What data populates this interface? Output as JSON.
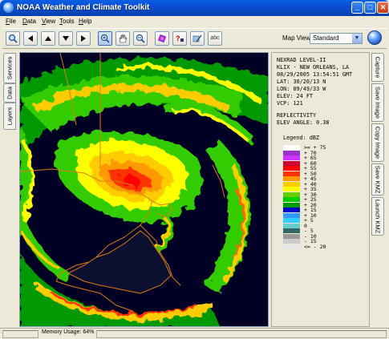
{
  "window": {
    "title": "NOAA Weather and Climate Toolkit",
    "minimize_label": "_",
    "maximize_label": "□",
    "close_label": "✕"
  },
  "menu": [
    "File",
    "Data",
    "View",
    "Tools",
    "Help"
  ],
  "toolbar": {
    "buttons": [
      "zoom-fit",
      "back",
      "up",
      "down",
      "forward",
      "zoom-in",
      "pan",
      "zoom-out",
      "palette",
      "identify",
      "edit-layers",
      "labels"
    ],
    "labels_text": "abc",
    "map_view_label": "Map View:",
    "map_view_value": "Standard"
  },
  "left_tabs": [
    "Services",
    "Data",
    "Layers"
  ],
  "right_tabs": [
    "Capture",
    "Save Image",
    "Copy Image",
    "Save KMZ",
    "Launch KMZ"
  ],
  "info": {
    "lines": [
      "NEXRAD LEVEL-II",
      "KLIX - NEW ORLEANS, LA",
      "08/29/2005 13:54:51 GMT",
      "LAT: 30/20/13 N",
      "LON: 89/49/33 W",
      "ELEV: 24 FT",
      "VCP: 121"
    ],
    "product": "REFLECTIVITY",
    "elev_angle": "ELEV ANGLE: 0.38",
    "legend_title": "Legend: dBZ",
    "legend": [
      {
        "label": ">= + 75",
        "color": "#fcfcfc"
      },
      {
        "label": "+ 70",
        "color": "#9933cc"
      },
      {
        "label": "+ 65",
        "color": "#cc33ff"
      },
      {
        "label": "+ 60",
        "color": "#cc0033"
      },
      {
        "label": "+ 55",
        "color": "#ff0000"
      },
      {
        "label": "+ 50",
        "color": "#ff3300"
      },
      {
        "label": "+ 45",
        "color": "#ff9900"
      },
      {
        "label": "+ 40",
        "color": "#ffcc00"
      },
      {
        "label": "+ 35",
        "color": "#ffff00"
      },
      {
        "label": "+ 30",
        "color": "#66cc00"
      },
      {
        "label": "+ 25",
        "color": "#00cc00"
      },
      {
        "label": "+ 20",
        "color": "#009900"
      },
      {
        "label": "+ 15",
        "color": "#0000cc"
      },
      {
        "label": "+ 10",
        "color": "#3399ff"
      },
      {
        "label": "+ 5",
        "color": "#33ccff"
      },
      {
        "label": "0",
        "color": "#66cccc"
      },
      {
        "label": "- 5",
        "color": "#336666"
      },
      {
        "label": "- 10",
        "color": "#999999"
      },
      {
        "label": "- 15",
        "color": "#cccccc"
      },
      {
        "label": "<= - 20",
        "color": "#e6e6e6"
      }
    ]
  },
  "status": {
    "memory": "Memory Usage: 64%"
  },
  "colors": {
    "titlebar": "#0a4fd0",
    "map_background": "#000024"
  }
}
